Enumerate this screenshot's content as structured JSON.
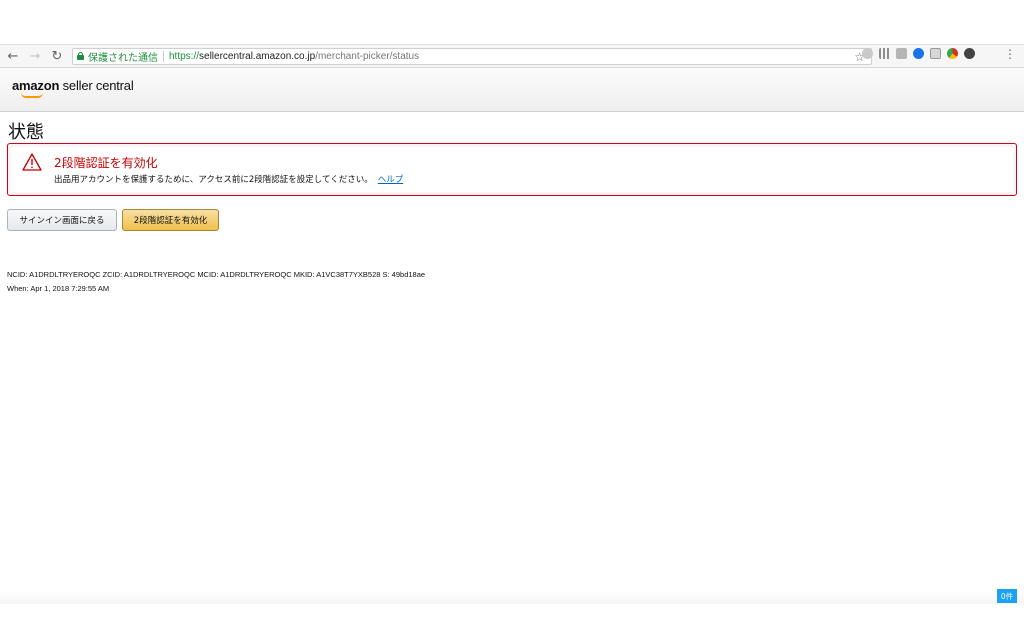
{
  "browser": {
    "secure_label": "保護された通信",
    "url_scheme": "https://",
    "url_host": "sellercentral.amazon.co.jp",
    "url_path": "/merchant-picker/status",
    "icons": [
      "back-arrow-icon",
      "forward-arrow-icon",
      "reload-icon",
      "lock-icon",
      "star-icon",
      "menu-dots-icon"
    ]
  },
  "header": {
    "logo_brand": "amazon",
    "logo_product": "seller central"
  },
  "page": {
    "title": "状態"
  },
  "alert": {
    "title": "2段階認証を有効化",
    "message": "出品用アカウントを保護するために、アクセス前に2段階認証を設定してください。",
    "help_link": "ヘルプ",
    "accent_color": "#d0021b"
  },
  "actions": {
    "back_label": "サインイン画面に戻る",
    "enable_label": "2段階認証を有効化"
  },
  "meta": {
    "ids_line": "NCID: A1DRDLTRYEROQC ZCID: A1DRDLTRYEROQC MCID: A1DRDLTRYEROQC MKID: A1VC38T7YXB528 S: 49bd18ae",
    "when_line": "When: Apr 1, 2018 7:29:55 AM"
  },
  "badge": {
    "count_label": "0件"
  }
}
